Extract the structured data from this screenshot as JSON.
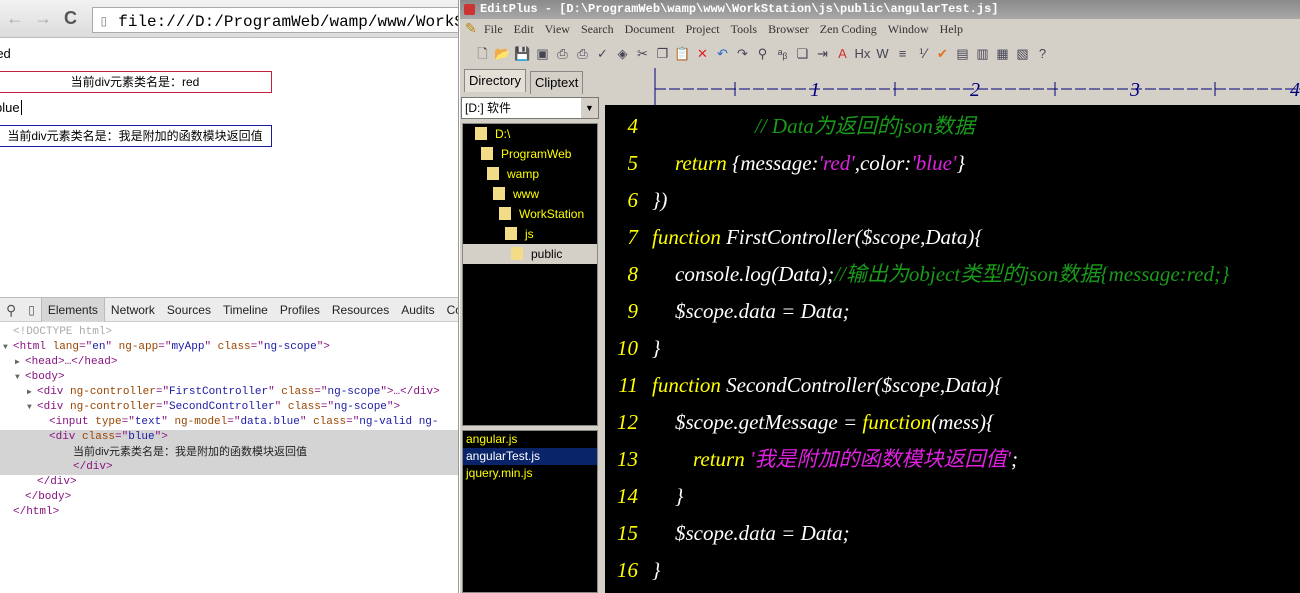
{
  "browser": {
    "address": "file:///D:/ProgramWeb/wamp/www/WorkStation/",
    "input1_value": "red",
    "box1_text": "当前div元素类名是：red",
    "input2_value": "blue",
    "box2_text": "当前div元素类名是：我是附加的函数模块返回值",
    "box1_color": "#c0203a",
    "box2_color": "#1a1aa0"
  },
  "devtools": {
    "tabs": [
      "Elements",
      "Network",
      "Sources",
      "Timeline",
      "Profiles",
      "Resources",
      "Audits",
      "Co"
    ],
    "active_tab": "Elements",
    "tree": [
      {
        "indent": 0,
        "arrow": "",
        "parts": [
          [
            "dc",
            "<!DOCTYPE html>"
          ]
        ]
      },
      {
        "indent": 0,
        "arrow": "▼",
        "parts": [
          [
            "tg",
            "<html "
          ],
          [
            "an",
            "lang"
          ],
          [
            "tg",
            "=\""
          ],
          [
            "av",
            "en"
          ],
          [
            "tg",
            "\" "
          ],
          [
            "an",
            "ng-app"
          ],
          [
            "tg",
            "=\""
          ],
          [
            "av",
            "myApp"
          ],
          [
            "tg",
            "\" "
          ],
          [
            "an",
            "class"
          ],
          [
            "tg",
            "=\""
          ],
          [
            "av",
            "ng-scope"
          ],
          [
            "tg",
            "\">"
          ]
        ]
      },
      {
        "indent": 1,
        "arrow": "▶",
        "parts": [
          [
            "tg",
            "<head>…</head>"
          ]
        ]
      },
      {
        "indent": 1,
        "arrow": "▼",
        "parts": [
          [
            "tg",
            "<body>"
          ]
        ]
      },
      {
        "indent": 2,
        "arrow": "▶",
        "parts": [
          [
            "tg",
            "<div "
          ],
          [
            "an",
            "ng-controller"
          ],
          [
            "tg",
            "=\""
          ],
          [
            "av",
            "FirstController"
          ],
          [
            "tg",
            "\" "
          ],
          [
            "an",
            "class"
          ],
          [
            "tg",
            "=\""
          ],
          [
            "av",
            "ng-scope"
          ],
          [
            "tg",
            "\">…</div>"
          ]
        ]
      },
      {
        "indent": 2,
        "arrow": "▼",
        "parts": [
          [
            "tg",
            "<div "
          ],
          [
            "an",
            "ng-controller"
          ],
          [
            "tg",
            "=\""
          ],
          [
            "av",
            "SecondController"
          ],
          [
            "tg",
            "\" "
          ],
          [
            "an",
            "class"
          ],
          [
            "tg",
            "=\""
          ],
          [
            "av",
            "ng-scope"
          ],
          [
            "tg",
            "\">"
          ]
        ]
      },
      {
        "indent": 3,
        "arrow": "",
        "parts": [
          [
            "tg",
            "<input "
          ],
          [
            "an",
            "type"
          ],
          [
            "tg",
            "=\""
          ],
          [
            "av",
            "text"
          ],
          [
            "tg",
            "\" "
          ],
          [
            "an",
            "ng-model"
          ],
          [
            "tg",
            "=\""
          ],
          [
            "av",
            "data.blue"
          ],
          [
            "tg",
            "\" "
          ],
          [
            "an",
            "class"
          ],
          [
            "tg",
            "=\""
          ],
          [
            "av",
            "ng-valid ng-"
          ]
        ]
      },
      {
        "indent": 3,
        "arrow": "",
        "sel": true,
        "parts": [
          [
            "tg",
            "<div "
          ],
          [
            "an",
            "class"
          ],
          [
            "tg",
            "=\""
          ],
          [
            "av",
            "blue"
          ],
          [
            "tg",
            "\">"
          ]
        ]
      },
      {
        "indent": 5,
        "arrow": "",
        "sel": true,
        "parts": [
          [
            "tx",
            "当前div元素类名是：我是附加的函数模块返回值"
          ]
        ]
      },
      {
        "indent": 5,
        "arrow": "",
        "sel": true,
        "parts": [
          [
            "tg",
            "</div>"
          ]
        ]
      },
      {
        "indent": 2,
        "arrow": "",
        "parts": [
          [
            "tg",
            "</div>"
          ]
        ]
      },
      {
        "indent": 1,
        "arrow": "",
        "parts": [
          [
            "tg",
            "</body>"
          ]
        ]
      },
      {
        "indent": 0,
        "arrow": "",
        "parts": [
          [
            "tg",
            "</html>"
          ]
        ]
      }
    ]
  },
  "editplus": {
    "title": "EditPlus - [D:\\ProgramWeb\\wamp\\www\\WorkStation\\js\\public\\angularTest.js]",
    "menu": [
      "File",
      "Edit",
      "View",
      "Search",
      "Document",
      "Project",
      "Tools",
      "Browser",
      "Zen Coding",
      "Window",
      "Help"
    ],
    "toolbar_icons": [
      "new-file-icon",
      "open-icon",
      "save-icon",
      "save-all-icon",
      "print-preview-icon",
      "print-icon",
      "spellcheck-icon",
      "browser-icon",
      "cut-icon",
      "copy-icon",
      "paste-icon",
      "delete-icon",
      "undo-icon",
      "redo-icon",
      "find-icon",
      "replace-icon",
      "find-in-files-icon",
      "goto-icon",
      "font-icon",
      "hex-icon",
      "word-wrap-icon",
      "line-number-icon",
      "ruler-icon",
      "check-icon",
      "panel-icon",
      "directory-icon",
      "cliptext-icon",
      "output-icon",
      "help-icon"
    ],
    "panel_tabs": [
      "Directory",
      "Cliptext"
    ],
    "drive": "[D:] 软件",
    "dirs": [
      "D:\\",
      "ProgramWeb",
      "wamp",
      "www",
      "WorkStation",
      "js",
      "public"
    ],
    "selected_dir": "public",
    "files": [
      "angular.js",
      "angularTest.js",
      "jquery.min.js"
    ],
    "selected_file": "angularTest.js",
    "ruler_marks": [
      "1",
      "2",
      "3",
      "4"
    ],
    "code": [
      {
        "n": "4",
        "indent": 4,
        "t": [
          [
            "cm",
            "// Data为返回的json数据"
          ]
        ]
      },
      {
        "n": "5",
        "indent": 1,
        "t": [
          [
            "kw",
            "return "
          ],
          [
            "id",
            "{message:"
          ],
          [
            "st",
            "'red'"
          ],
          [
            "id",
            ",color:"
          ],
          [
            "st",
            "'blue'"
          ],
          [
            "id",
            "}"
          ]
        ]
      },
      {
        "n": "6",
        "indent": 0,
        "t": [
          [
            "id",
            "})"
          ]
        ]
      },
      {
        "n": "7",
        "indent": 0,
        "t": [
          [
            "kw",
            "function "
          ],
          [
            "id",
            "FirstController($scope,Data){"
          ]
        ]
      },
      {
        "n": "8",
        "indent": 1,
        "t": [
          [
            "id",
            "console.log(Data);"
          ],
          [
            "cm",
            "//输出为object类型的json数据{message:red;}"
          ]
        ]
      },
      {
        "n": "9",
        "indent": 1,
        "t": [
          [
            "id",
            "$scope.data = Data;"
          ]
        ]
      },
      {
        "n": "10",
        "indent": 0,
        "t": [
          [
            "id",
            "}"
          ]
        ]
      },
      {
        "n": "11",
        "indent": 0,
        "t": [
          [
            "kw",
            "function "
          ],
          [
            "id",
            "SecondController($scope,Data){"
          ]
        ]
      },
      {
        "n": "12",
        "indent": 1,
        "t": [
          [
            "id",
            "$scope.getMessage = "
          ],
          [
            "kw",
            "function"
          ],
          [
            "id",
            "(mess){"
          ]
        ]
      },
      {
        "n": "13",
        "indent": 2,
        "t": [
          [
            "kw",
            "return "
          ],
          [
            "st",
            "'我是附加的函数模块返回值'"
          ],
          [
            "id",
            ";"
          ]
        ]
      },
      {
        "n": "14",
        "indent": 1,
        "t": [
          [
            "id",
            "}"
          ]
        ]
      },
      {
        "n": "15",
        "indent": 1,
        "t": [
          [
            "id",
            "$scope.data = Data;"
          ]
        ]
      },
      {
        "n": "16",
        "indent": 0,
        "t": [
          [
            "id",
            "}"
          ]
        ]
      }
    ]
  }
}
